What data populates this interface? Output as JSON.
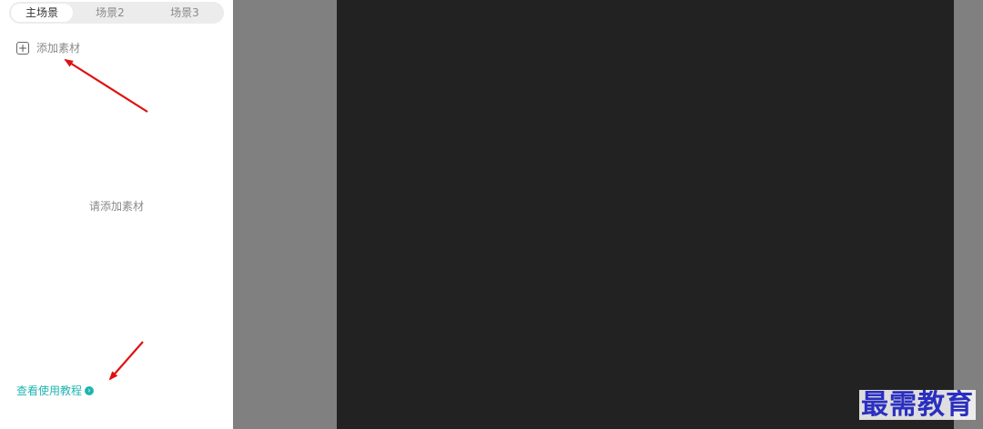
{
  "scene_tabs": [
    {
      "label": "主场景",
      "active": true
    },
    {
      "label": "场景2",
      "active": false
    },
    {
      "label": "场景3",
      "active": false
    }
  ],
  "add_material": {
    "label": "添加素材",
    "icon": "plus-square-icon"
  },
  "empty_hint": "请添加素材",
  "tutorial": {
    "label": "查看使用教程",
    "icon": "arrow-right-circle-icon"
  },
  "watermark": "最需教育",
  "colors": {
    "accent": "#1fb5b0",
    "canvas_bg": "#808080",
    "stage_bg": "#222222",
    "annotation_arrow": "#e01010",
    "watermark": "#2a2fc0"
  }
}
